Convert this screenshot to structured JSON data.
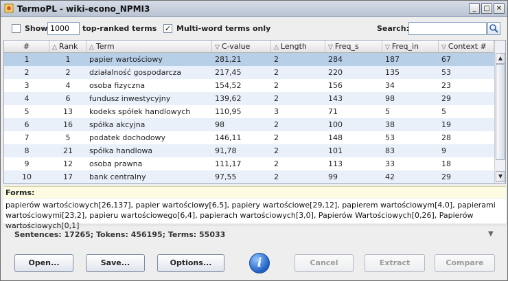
{
  "window": {
    "title": "TermoPL - wiki-econo_NPMI3"
  },
  "toolbar": {
    "show_label": "Show",
    "show_checked": false,
    "show_value": "1000",
    "top_ranked_label": "top-ranked terms",
    "multiword_checked": true,
    "multiword_label": "Multi-word terms only",
    "search_label": "Search:",
    "search_value": ""
  },
  "table": {
    "columns": [
      "#",
      "Rank",
      "Term",
      "C-value",
      "Length",
      "Freq_s",
      "Freq_in",
      "Context #"
    ],
    "rows": [
      [
        "1",
        "1",
        "papier wartościowy",
        "281,21",
        "2",
        "284",
        "187",
        "67"
      ],
      [
        "2",
        "2",
        "działalność gospodarcza",
        "217,45",
        "2",
        "220",
        "135",
        "53"
      ],
      [
        "3",
        "4",
        "osoba fizyczna",
        "154,52",
        "2",
        "156",
        "34",
        "23"
      ],
      [
        "4",
        "6",
        "fundusz inwestycyjny",
        "139,62",
        "2",
        "143",
        "98",
        "29"
      ],
      [
        "5",
        "13",
        "kodeks spółek handlowych",
        "110,95",
        "3",
        "71",
        "5",
        "5"
      ],
      [
        "6",
        "16",
        "spółka akcyjna",
        "98",
        "2",
        "100",
        "38",
        "19"
      ],
      [
        "7",
        "5",
        "podatek dochodowy",
        "146,11",
        "2",
        "148",
        "53",
        "28"
      ],
      [
        "8",
        "21",
        "spółka handlowa",
        "91,78",
        "2",
        "101",
        "83",
        "9"
      ],
      [
        "9",
        "12",
        "osoba prawna",
        "111,17",
        "2",
        "113",
        "33",
        "18"
      ],
      [
        "10",
        "17",
        "bank centralny",
        "97,55",
        "2",
        "99",
        "42",
        "29"
      ]
    ]
  },
  "forms": {
    "heading": "Forms:",
    "line1": "papierów wartościowych[26,137], papier wartościowy[6,5], papiery wartościowe[29,12], papierem wartościowym[4,0], papierami",
    "line2": "wartościowymi[23,2], papieru wartościowego[6,4], papierach wartościowych[3,0], Papierów Wartościowych[0,26], Papierów wartościowych[0,1]"
  },
  "stats": {
    "text": "Sentences: 17265; Tokens: 456195; Terms: 55033"
  },
  "buttons": {
    "open": "Open...",
    "save": "Save...",
    "options": "Options...",
    "info": "i",
    "cancel": "Cancel",
    "extract": "Extract",
    "compare": "Compare"
  }
}
